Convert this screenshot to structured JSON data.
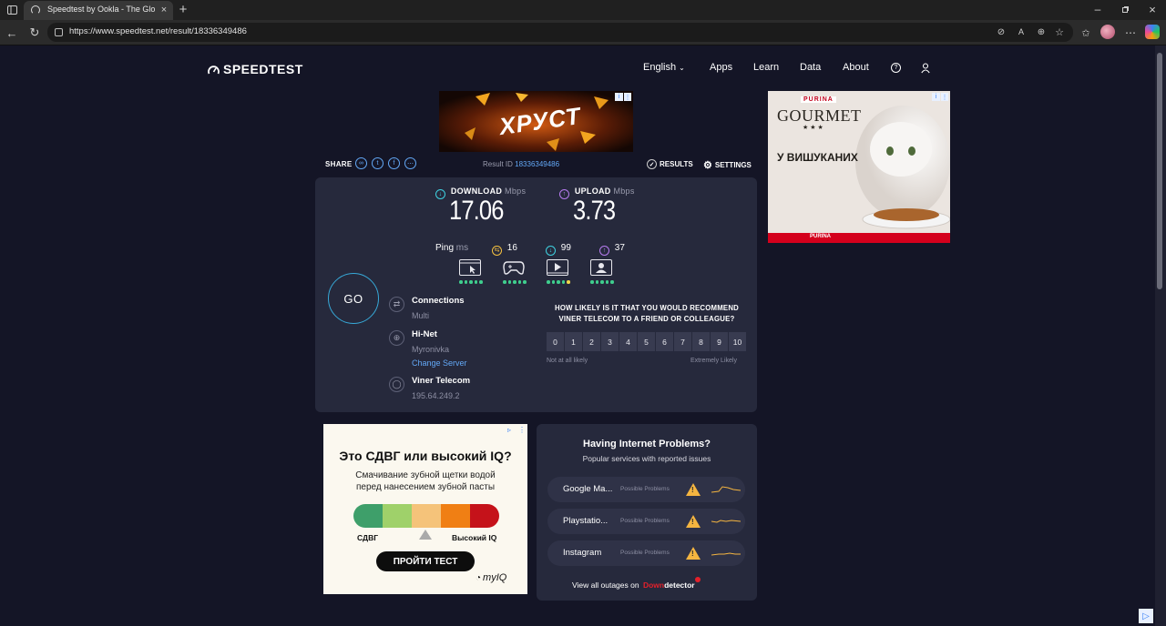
{
  "browser": {
    "tab_title": "Speedtest by Ookla - The Global B",
    "url": "https://www.speedtest.net/result/18336349486",
    "icons": [
      "sidebar-toggle-icon",
      "back-icon",
      "refresh-icon",
      "site-info-icon",
      "new-tab-icon",
      "minimize-icon",
      "maximize-icon",
      "close-icon",
      "favorites-icon",
      "profile-avatar",
      "more-icon",
      "copilot-icon"
    ]
  },
  "header": {
    "logo": "SPEEDTEST",
    "nav": [
      "English",
      "Apps",
      "Learn",
      "Data",
      "About"
    ]
  },
  "ads": {
    "top_text": "ХРУСТ",
    "right_brand_top": "PURINA",
    "right_brand": "GOURMET",
    "right_stars": "★ ★ ★",
    "right_text": "У ВИШУКАНИХ",
    "right_footer": "PURINA",
    "left_title": "Это СДВГ или высокий IQ?",
    "left_sub": "Смачивание зубной щетки водой перед нанесением зубной пасты",
    "left_low": "СДВГ",
    "left_high": "Высокий IQ",
    "left_button": "ПРОЙТИ ТЕСТ",
    "left_brand": "myIQ"
  },
  "share": {
    "label": "SHARE",
    "result_id_label": "Result ID",
    "result_id": "18336349486",
    "results_label": "RESULTS",
    "settings_label": "SETTINGS"
  },
  "result": {
    "download_label": "DOWNLOAD",
    "upload_label": "UPLOAD",
    "unit": "Mbps",
    "download": "17.06",
    "upload": "3.73",
    "ping_label": "Ping",
    "ping_unit": "ms",
    "ping_idle": "16",
    "ping_down": "99",
    "ping_up": "37",
    "go": "GO",
    "connections_label": "Connections",
    "connections_value": "Multi",
    "server_name": "Hi-Net",
    "server_city": "Myronivka",
    "change_server": "Change Server",
    "isp": "Viner Telecom",
    "ip": "195.64.249.2",
    "activity_ratings": [
      {
        "name": "browsing",
        "score": 5
      },
      {
        "name": "gaming",
        "score": 5
      },
      {
        "name": "streaming",
        "score": 4
      },
      {
        "name": "video-calls",
        "score": 5
      }
    ]
  },
  "recommend": {
    "question": "HOW LIKELY IS IT THAT YOU WOULD RECOMMEND VINER TELECOM TO A FRIEND OR COLLEAGUE?",
    "scale": [
      "0",
      "1",
      "2",
      "3",
      "4",
      "5",
      "6",
      "7",
      "8",
      "9",
      "10"
    ],
    "low_label": "Not at all likely",
    "high_label": "Extremely Likely"
  },
  "problems": {
    "title": "Having Internet Problems?",
    "subtitle": "Popular services with reported issues",
    "tag": "Possible Problems",
    "services": [
      "Google Ma...",
      "Playstatio...",
      "Instagram"
    ],
    "footer": "View all outages on",
    "footer_brand_a": "Down",
    "footer_brand_b": "detector"
  }
}
